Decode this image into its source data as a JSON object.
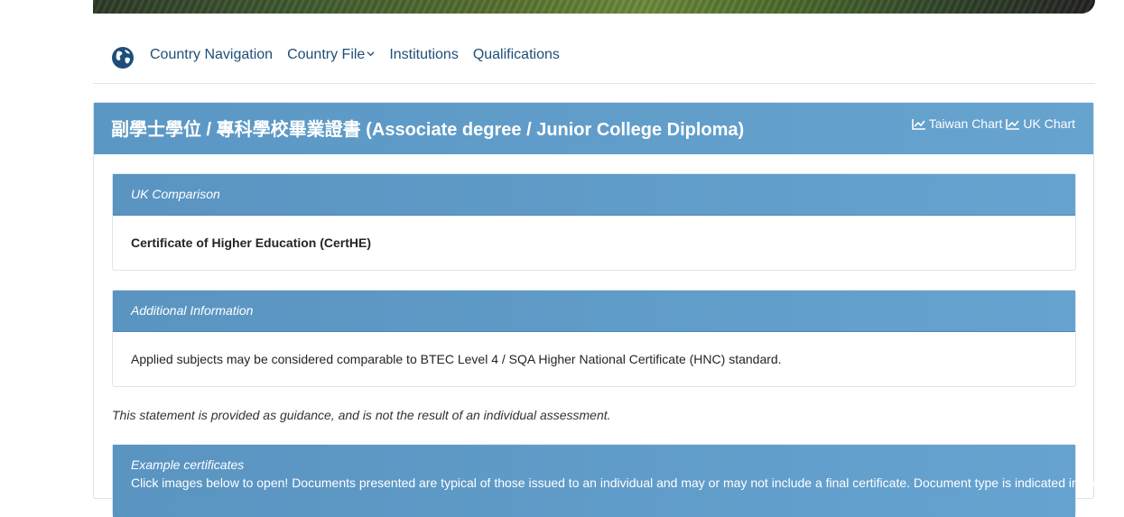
{
  "nav": {
    "items": [
      "Country Navigation",
      "Country File",
      "Institutions",
      "Qualifications"
    ]
  },
  "qualification": {
    "title": "副學士學位 / 專科學校畢業證書 (Associate degree / Junior College Diploma)",
    "taiwan_chart": "Taiwan Chart",
    "uk_chart": "UK Chart"
  },
  "uk_comparison": {
    "heading": "UK Comparison",
    "value": "Certificate of Higher Education (CertHE)"
  },
  "additional_info": {
    "heading": "Additional Information",
    "text": "Applied subjects may be considered comparable to BTEC Level 4 / SQA Higher National Certificate (HNC) standard."
  },
  "statement": "This statement is provided as guidance, and is not the result of an individual assessment.",
  "examples": {
    "heading": "Example certificates",
    "text": "Click images below to open! Documents presented are typical of those issued to an individual and may or may not include a final certificate. Document type is indicated in the"
  },
  "colors": {
    "header_blue": "#5f9cc8",
    "link_blue": "#1f4e79"
  },
  "icons": [
    "globe-icon",
    "chevron-down-icon",
    "line-chart-icon"
  ]
}
